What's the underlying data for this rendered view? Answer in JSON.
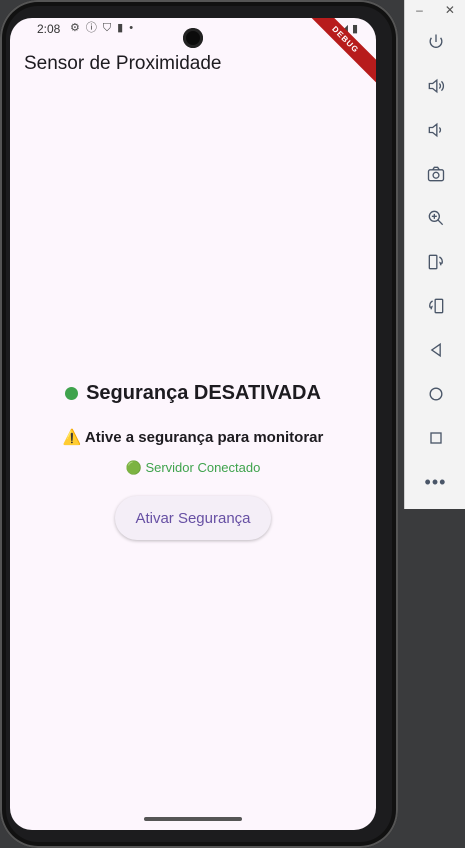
{
  "status_bar": {
    "time": "2:08",
    "icons": [
      "gear-icon",
      "info-icon",
      "shield-icon",
      "sim-icon",
      "dot-icon"
    ],
    "right_icons": [
      "wifi-icon",
      "signal-icon",
      "battery-icon"
    ]
  },
  "debug_banner": "DEBUG",
  "app": {
    "title": "Sensor de Proximidade"
  },
  "main": {
    "status_title": "Segurança DESATIVADA",
    "status_color": "#3fa34d",
    "warning_text": "⚠️ Ative a segurança para monitorar",
    "server_text": "🟢 Servidor Conectado",
    "action_button": "Ativar Segurança"
  },
  "toolbar": {
    "window_minimize": "–",
    "window_close": "✕",
    "buttons": [
      "power-icon",
      "volume-up-icon",
      "volume-down-icon",
      "camera-icon",
      "zoom-icon",
      "rotate-left-icon",
      "rotate-right-icon",
      "back-icon",
      "home-icon",
      "overview-icon",
      "more-icon"
    ],
    "more_label": "•••"
  }
}
